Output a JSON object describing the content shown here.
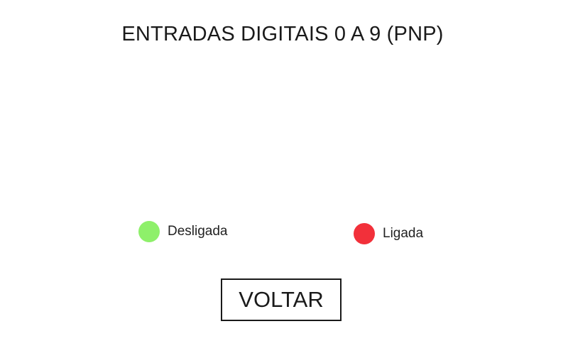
{
  "header": {
    "title": "ENTRADAS DIGITAIS 0 A 9 (PNP)"
  },
  "legend": {
    "items": [
      {
        "label": "Desligada",
        "color": "#8ef06a",
        "icon": "status-dot-green"
      },
      {
        "label": "Ligada",
        "color": "#f2303a",
        "icon": "status-dot-red"
      }
    ]
  },
  "actions": {
    "back_label": "VOLTAR"
  }
}
